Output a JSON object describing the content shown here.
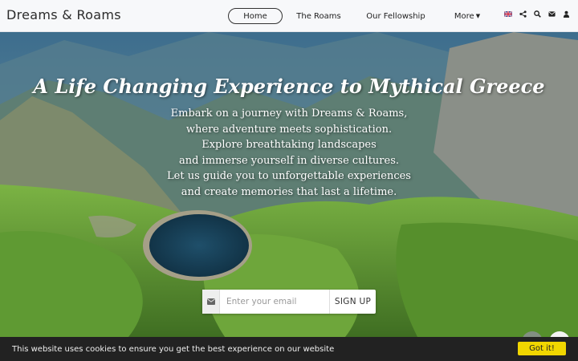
{
  "brand": "Dreams & Roams",
  "nav": {
    "home": "Home",
    "roams": "The Roams",
    "fellowship": "Our Fellowship",
    "more": "More"
  },
  "icons": [
    "uk-flag-icon",
    "share-icon",
    "search-icon",
    "envelope-icon",
    "user-icon"
  ],
  "hero": {
    "headline": "A Life Changing Experience to Mythical Greece",
    "lines": [
      "Embark on a journey with Dreams & Roams,",
      "where adventure meets sophistication.",
      "Explore breathtaking landscapes",
      "and immerse yourself in diverse cultures.",
      "Let us guide you to unforgettable experiences",
      "and create memories that last a lifetime."
    ]
  },
  "signup": {
    "placeholder": "Enter your email",
    "button": "SIGN UP"
  },
  "cookie": {
    "message": "This website uses cookies to ensure you get the best experience on our website",
    "button": "Got it!"
  },
  "colors": {
    "cookie_button": "#f1d600",
    "cookie_bar": "#222222",
    "navbar": "#f7f8fa"
  }
}
